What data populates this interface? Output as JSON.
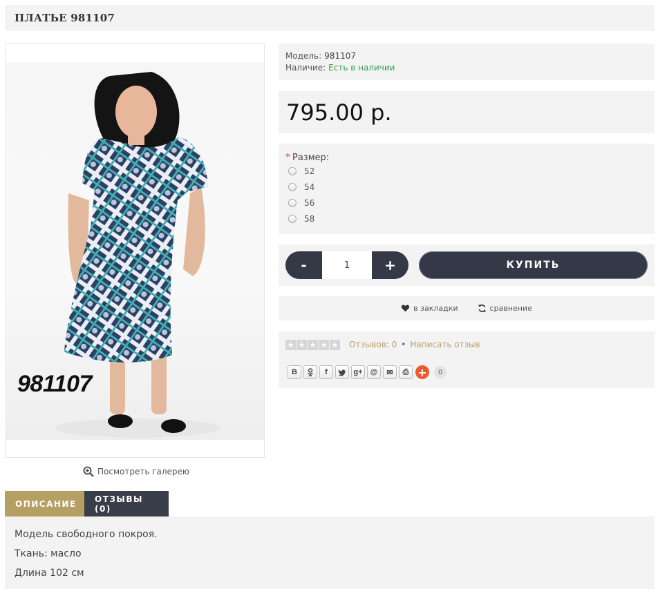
{
  "product": {
    "title": "ПЛАТЬЕ 981107",
    "image_code": "981107",
    "gallery_link": "Посмотреть галерею"
  },
  "info": {
    "model_label": "Модель:",
    "model_value": "981107",
    "stock_label": "Наличие:",
    "stock_value": "Есть в наличии"
  },
  "price": "795.00 р.",
  "options": {
    "required_mark": "*",
    "label": "Размер:",
    "sizes": [
      "52",
      "54",
      "56",
      "58"
    ]
  },
  "purchase": {
    "minus": "-",
    "quantity": "1",
    "plus": "+",
    "buy_label": "КУПИТЬ"
  },
  "actions": {
    "bookmark": "в закладки",
    "compare": "сравнение"
  },
  "reviews": {
    "rating": 0,
    "count_label": "Отзывов: 0",
    "separator": "•",
    "write_label": "Написать отзыв"
  },
  "share": {
    "icons": [
      "В",
      "ok",
      "f",
      "tw",
      "g+",
      "@",
      "✉",
      "⎙"
    ],
    "count": "0"
  },
  "tabs": {
    "description": "ОПИСАНИЕ",
    "reviews": "ОТЗЫВЫ (0)"
  },
  "description": [
    "Модель свободного покроя.",
    "Ткань: масло",
    "Длина 102 см"
  ],
  "colors": {
    "accent_gold": "#b69f63",
    "dark_button": "#353846",
    "in_stock": "#3a9a4d",
    "panel_bg": "#f3f3f3"
  }
}
